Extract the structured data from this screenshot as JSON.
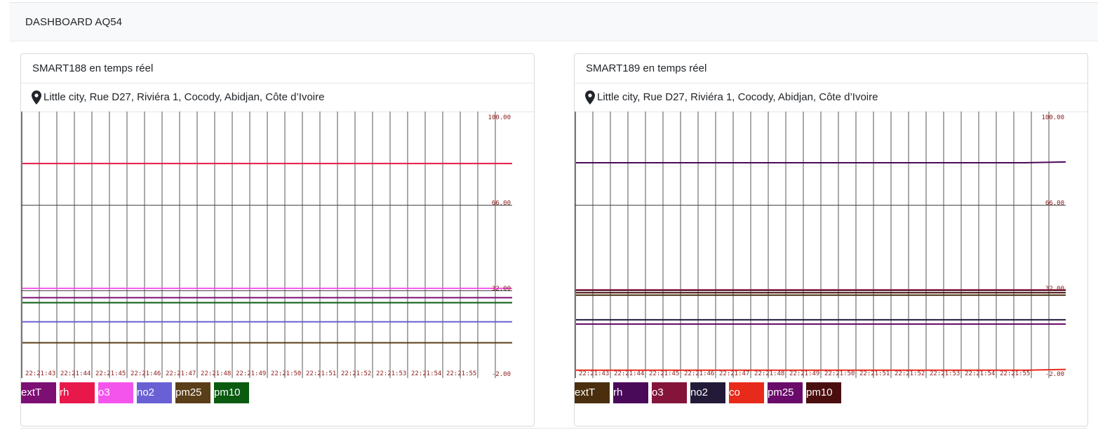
{
  "navbar": {
    "brand": "DASHBOARD AQ54"
  },
  "cards": [
    {
      "title": "SMART188 en temps réel",
      "location": "Little city, Rue D27, Riviéra 1, Cocody, Abidjan, Côte d’Ivoire",
      "legend": [
        {
          "label": "extT",
          "color": "#7d0e74"
        },
        {
          "label": "rh",
          "color": "#e8184a"
        },
        {
          "label": "o3",
          "color": "#f554ec"
        },
        {
          "label": "no2",
          "color": "#6a60d6"
        },
        {
          "label": "pm25",
          "color": "#5a3e18"
        },
        {
          "label": "pm10",
          "color": "#0a5a10"
        }
      ],
      "chart_data": {
        "type": "line",
        "x": [
          "22:21:43",
          "22:21:44",
          "22:21:45",
          "22:21:46",
          "22:21:47",
          "22:21:48",
          "22:21:49",
          "22:21:50",
          "22:21:51",
          "22:21:52",
          "22:21:53",
          "22:21:54",
          "22:21:55"
        ],
        "y_ticks": [
          "100.00",
          "66.00",
          "32.00",
          "-2.00"
        ],
        "ylim": [
          -2,
          100
        ],
        "grid": true,
        "series": [
          {
            "name": "extT",
            "color": "#7d0e74",
            "values": [
              28.0,
              28.0,
              28.0,
              28.0,
              28.0,
              28.0,
              28.0,
              28.0,
              28.0,
              28.0,
              28.0,
              28.0,
              28.0
            ]
          },
          {
            "name": "rh",
            "color": "#e8184a",
            "values": [
              81.3,
              81.3,
              81.3,
              81.3,
              81.3,
              81.3,
              81.3,
              81.3,
              81.3,
              81.3,
              81.3,
              81.3,
              81.3
            ]
          },
          {
            "name": "o3",
            "color": "#f554ec",
            "values": [
              31.7,
              31.7,
              31.7,
              31.7,
              31.7,
              31.7,
              31.7,
              31.7,
              31.7,
              31.7,
              31.7,
              31.7,
              31.7
            ]
          },
          {
            "name": "no2",
            "color": "#6a60d6",
            "values": [
              18.4,
              18.4,
              18.4,
              18.4,
              18.4,
              18.4,
              18.4,
              18.4,
              18.4,
              18.4,
              18.4,
              18.4,
              18.4
            ]
          },
          {
            "name": "pm25",
            "color": "#5a3e18",
            "values": [
              10.1,
              10.1,
              10.1,
              10.1,
              10.1,
              10.1,
              10.1,
              10.1,
              10.1,
              10.1,
              10.1,
              10.1,
              10.1
            ]
          },
          {
            "name": "pm10",
            "color": "#0a5a10",
            "values": [
              26.0,
              26.0,
              26.0,
              26.0,
              26.0,
              26.0,
              26.0,
              26.0,
              26.0,
              26.0,
              26.0,
              26.0,
              26.0
            ]
          }
        ]
      }
    },
    {
      "title": "SMART189 en temps réel",
      "location": "Little city, Rue D27, Riviéra 1, Cocody, Abidjan, Côte d’Ivoire",
      "legend": [
        {
          "label": "extT",
          "color": "#4a2e0e"
        },
        {
          "label": "rh",
          "color": "#4a0a5a"
        },
        {
          "label": "o3",
          "color": "#84143a"
        },
        {
          "label": "no2",
          "color": "#221a38"
        },
        {
          "label": "co",
          "color": "#e82a1a"
        },
        {
          "label": "pm25",
          "color": "#6a0a6a"
        },
        {
          "label": "pm10",
          "color": "#4a0e0e"
        }
      ],
      "chart_data": {
        "type": "line",
        "x": [
          "22:21:43",
          "22:21:44",
          "22:21:45",
          "22:21:46",
          "22:21:47",
          "22:21:48",
          "22:21:49",
          "22:21:50",
          "22:21:51",
          "22:21:52",
          "22:21:53",
          "22:21:54",
          "22:21:55"
        ],
        "y_ticks": [
          "100.00",
          "66.00",
          "32.00",
          "-2.00"
        ],
        "ylim": [
          -2,
          100
        ],
        "grid": true,
        "series": [
          {
            "name": "extT",
            "color": "#4a2e0e",
            "values": [
              29.0,
              29.0,
              29.0,
              29.0,
              29.0,
              29.0,
              29.0,
              29.0,
              29.0,
              29.0,
              29.0,
              29.0,
              29.0
            ]
          },
          {
            "name": "rh",
            "color": "#4a0a5a",
            "values": [
              81.6,
              81.6,
              81.6,
              81.6,
              81.6,
              81.6,
              81.6,
              81.6,
              81.6,
              81.6,
              81.6,
              81.6,
              81.9
            ]
          },
          {
            "name": "o3",
            "color": "#84143a",
            "values": [
              31.1,
              31.1,
              31.1,
              31.1,
              31.1,
              31.1,
              31.1,
              31.1,
              31.1,
              31.1,
              31.1,
              31.1,
              31.1
            ]
          },
          {
            "name": "no2",
            "color": "#221a38",
            "values": [
              19.2,
              19.2,
              19.2,
              19.2,
              19.2,
              19.2,
              19.2,
              19.2,
              19.2,
              19.2,
              19.2,
              19.2,
              19.2
            ]
          },
          {
            "name": "co",
            "color": "#e82a1a",
            "values": [
              -0.8,
              -0.8,
              -0.8,
              -0.8,
              -0.8,
              -0.8,
              -0.8,
              -0.8,
              -0.8,
              -0.8,
              -0.8,
              -0.8,
              -0.5
            ]
          },
          {
            "name": "pm25",
            "color": "#6a0a6a",
            "values": [
              17.5,
              17.5,
              17.5,
              17.5,
              17.5,
              17.5,
              17.5,
              17.5,
              17.5,
              17.5,
              17.5,
              17.5,
              17.5
            ]
          },
          {
            "name": "pm10",
            "color": "#4a0e0e",
            "values": [
              30.0,
              30.0,
              30.0,
              30.0,
              30.0,
              30.0,
              30.0,
              30.0,
              30.0,
              30.0,
              30.0,
              30.0,
              30.0
            ]
          }
        ]
      }
    }
  ]
}
